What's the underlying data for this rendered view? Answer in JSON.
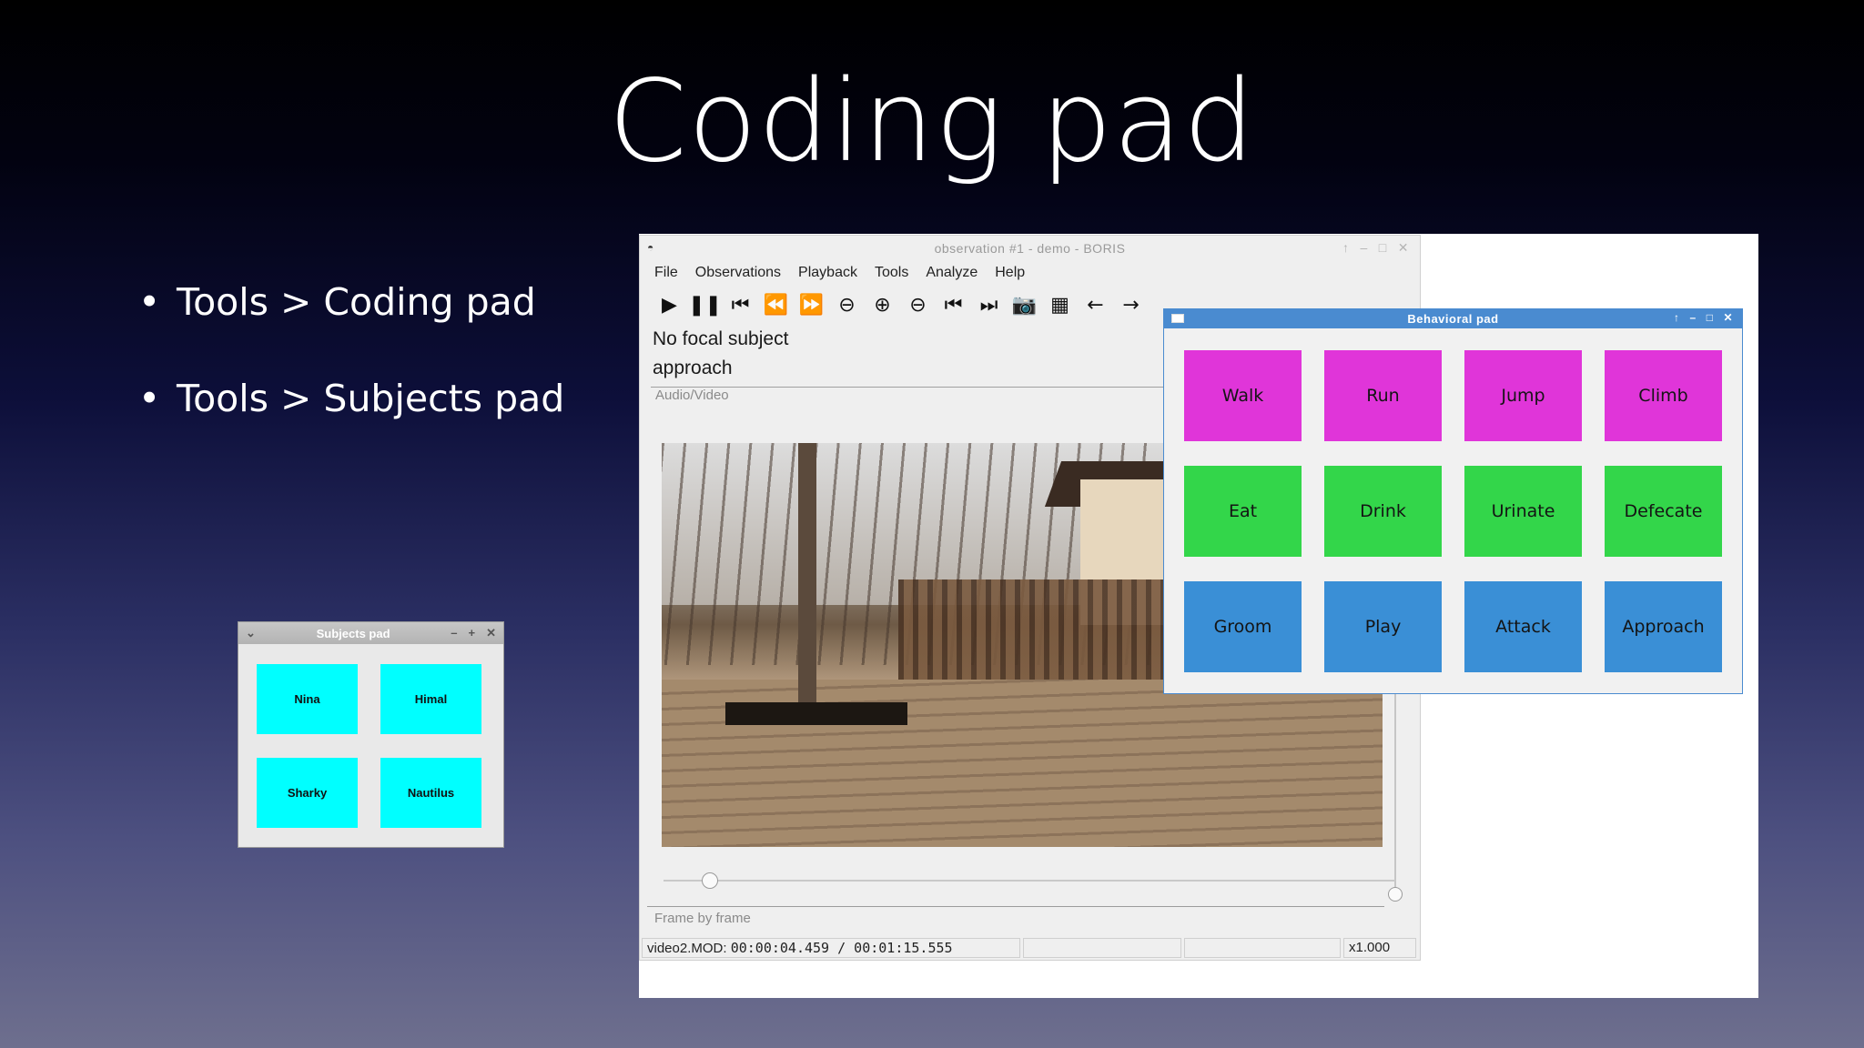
{
  "slide": {
    "title": "Coding pad",
    "bullets": [
      "Tools > Coding pad",
      "Tools > Subjects pad"
    ]
  },
  "subjects_pad": {
    "title": "Subjects pad",
    "color": "#00ffff",
    "subjects": [
      "Nina",
      "Himal",
      "Sharky",
      "Nautilus"
    ]
  },
  "boris": {
    "title": "observation #1 - demo - BORIS",
    "menu": [
      "File",
      "Observations",
      "Playback",
      "Tools",
      "Analyze",
      "Help"
    ],
    "toolbar_icons": [
      "play-icon",
      "pause-icon",
      "skip-back-icon",
      "rewind-icon",
      "fast-forward-icon",
      "minus-circle-icon",
      "plus-circle-icon",
      "minus-circle-icon",
      "previous-media-icon",
      "next-media-icon",
      "camera-icon",
      "film-icon",
      "arrow-left-icon",
      "arrow-right-icon"
    ],
    "focal_subject": "No focal subject",
    "current_behavior": "approach",
    "tab_label": "Audio/Video",
    "lower_tab_label": "Frame by frame",
    "status": {
      "media_name": "video2.MOD:",
      "time": "00:00:04.459 / 00:01:15.555",
      "speed": "x1.000"
    }
  },
  "behavioral_pad": {
    "title": "Behavioral pad",
    "behaviors": [
      {
        "label": "Walk",
        "color": "#e035d9"
      },
      {
        "label": "Run",
        "color": "#e035d9"
      },
      {
        "label": "Jump",
        "color": "#e035d9"
      },
      {
        "label": "Climb",
        "color": "#e035d9"
      },
      {
        "label": "Eat",
        "color": "#33d64a"
      },
      {
        "label": "Drink",
        "color": "#33d64a"
      },
      {
        "label": "Urinate",
        "color": "#33d64a"
      },
      {
        "label": "Defecate",
        "color": "#33d64a"
      },
      {
        "label": "Groom",
        "color": "#3a8fd6"
      },
      {
        "label": "Play",
        "color": "#3a8fd6"
      },
      {
        "label": "Attack",
        "color": "#3a8fd6"
      },
      {
        "label": "Approach",
        "color": "#3a8fd6"
      }
    ]
  }
}
